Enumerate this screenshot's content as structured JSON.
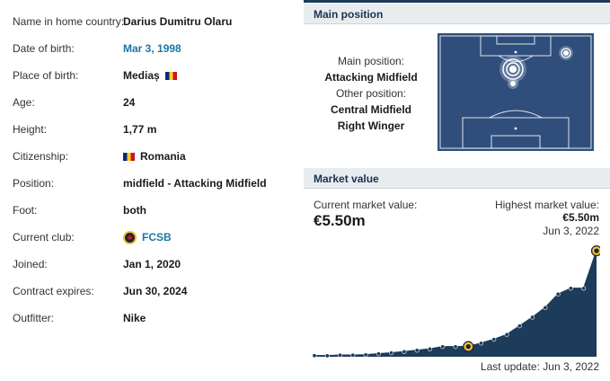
{
  "info": {
    "rows": [
      {
        "label": "Name in home country:",
        "value": "Darius Dumitru Olaru"
      },
      {
        "label": "Date of birth:",
        "value": "Mar 3, 1998"
      },
      {
        "label": "Place of birth:",
        "value": "Mediaș"
      },
      {
        "label": "Age:",
        "value": "24"
      },
      {
        "label": "Height:",
        "value": "1,77 m"
      },
      {
        "label": "Citizenship:",
        "value": "Romania"
      },
      {
        "label": "Position:",
        "value": "midfield - Attacking Midfield"
      },
      {
        "label": "Foot:",
        "value": "both"
      },
      {
        "label": "Current club:",
        "value": "FCSB"
      },
      {
        "label": "Joined:",
        "value": "Jan 1, 2020"
      },
      {
        "label": "Contract expires:",
        "value": "Jun 30, 2024"
      },
      {
        "label": "Outfitter:",
        "value": "Nike"
      }
    ]
  },
  "main_position": {
    "header": "Main position",
    "main_label": "Main position:",
    "main_value": "Attacking Midfield",
    "other_label": "Other position:",
    "other_values": [
      "Central Midfield",
      "Right Winger"
    ]
  },
  "market_value": {
    "header": "Market value",
    "current_label": "Current market value:",
    "current_value": "€5.50m",
    "highest_label": "Highest market value:",
    "highest_value": "€5.50m",
    "highest_date": "Jun 3, 2022",
    "last_update": "Last update: Jun 3, 2022"
  },
  "colors": {
    "navy": "#1d3b5a",
    "pitch": "#2f4e7c",
    "link": "#1d75a3",
    "header_bg": "#e9ecef"
  },
  "chart_data": {
    "type": "area",
    "values": [
      0.06,
      0.05,
      0.08,
      0.08,
      0.1,
      0.15,
      0.2,
      0.26,
      0.33,
      0.4,
      0.52,
      0.52,
      0.53,
      0.7,
      0.9,
      1.15,
      1.6,
      2.05,
      2.55,
      3.25,
      3.55,
      3.55,
      5.5
    ],
    "highlight_indices": [
      12,
      22
    ],
    "ylim": [
      0,
      5.6
    ]
  }
}
